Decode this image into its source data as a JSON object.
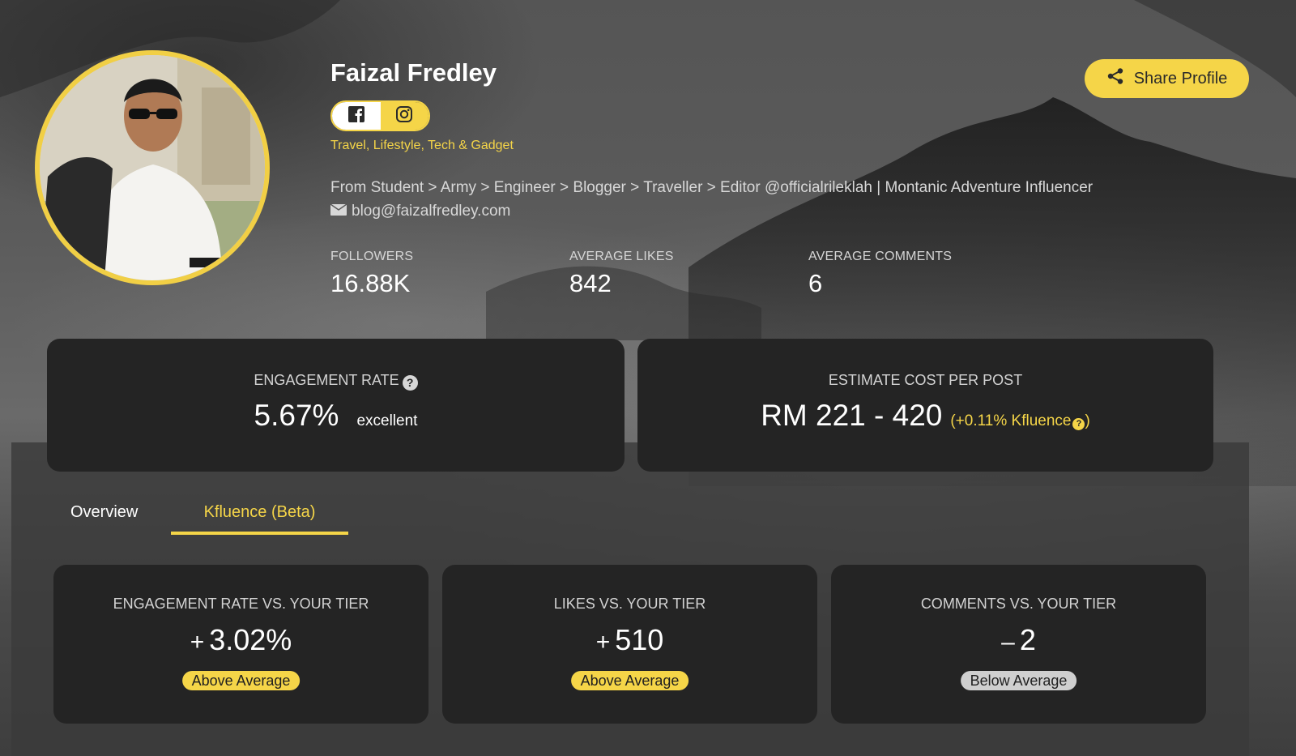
{
  "profile": {
    "name": "Faizal Fredley",
    "categories": "Travel, Lifestyle, Tech & Gadget",
    "bio": "From Student > Army > Engineer > Blogger > Traveller > Editor @officialrileklah | Montanic Adventure Influencer",
    "email": "blog@faizalfredley.com",
    "social": [
      "facebook-icon",
      "instagram-icon"
    ]
  },
  "share": {
    "label": "Share Profile",
    "icon": "share-icon"
  },
  "stats": [
    {
      "label": "FOLLOWERS",
      "value": "16.88K"
    },
    {
      "label": "AVERAGE LIKES",
      "value": "842"
    },
    {
      "label": "AVERAGE COMMENTS",
      "value": "6"
    }
  ],
  "engagement": {
    "label": "ENGAGEMENT RATE",
    "value": "5.67%",
    "rating": "excellent"
  },
  "cost": {
    "label": "ESTIMATE COST PER POST",
    "value": "RM 221 - 420",
    "note_prefix": "(+0.11% Kfluence",
    "note_suffix": ")"
  },
  "tabs": [
    {
      "label": "Overview",
      "active": false
    },
    {
      "label": "Kfluence (Beta)",
      "active": true
    }
  ],
  "tiers": [
    {
      "title": "ENGAGEMENT RATE VS. YOUR TIER",
      "sign": "+",
      "value": "3.02%",
      "badge": "Above Average"
    },
    {
      "title": "LIKES VS. YOUR TIER",
      "sign": "+",
      "value": "510",
      "badge": "Above Average"
    },
    {
      "title": "COMMENTS VS. YOUR TIER",
      "sign": "–",
      "value": "2",
      "badge": "Below Average"
    }
  ],
  "colors": {
    "accent": "#f5d548",
    "card": "#242424",
    "below_badge": "#cfcfcf"
  }
}
